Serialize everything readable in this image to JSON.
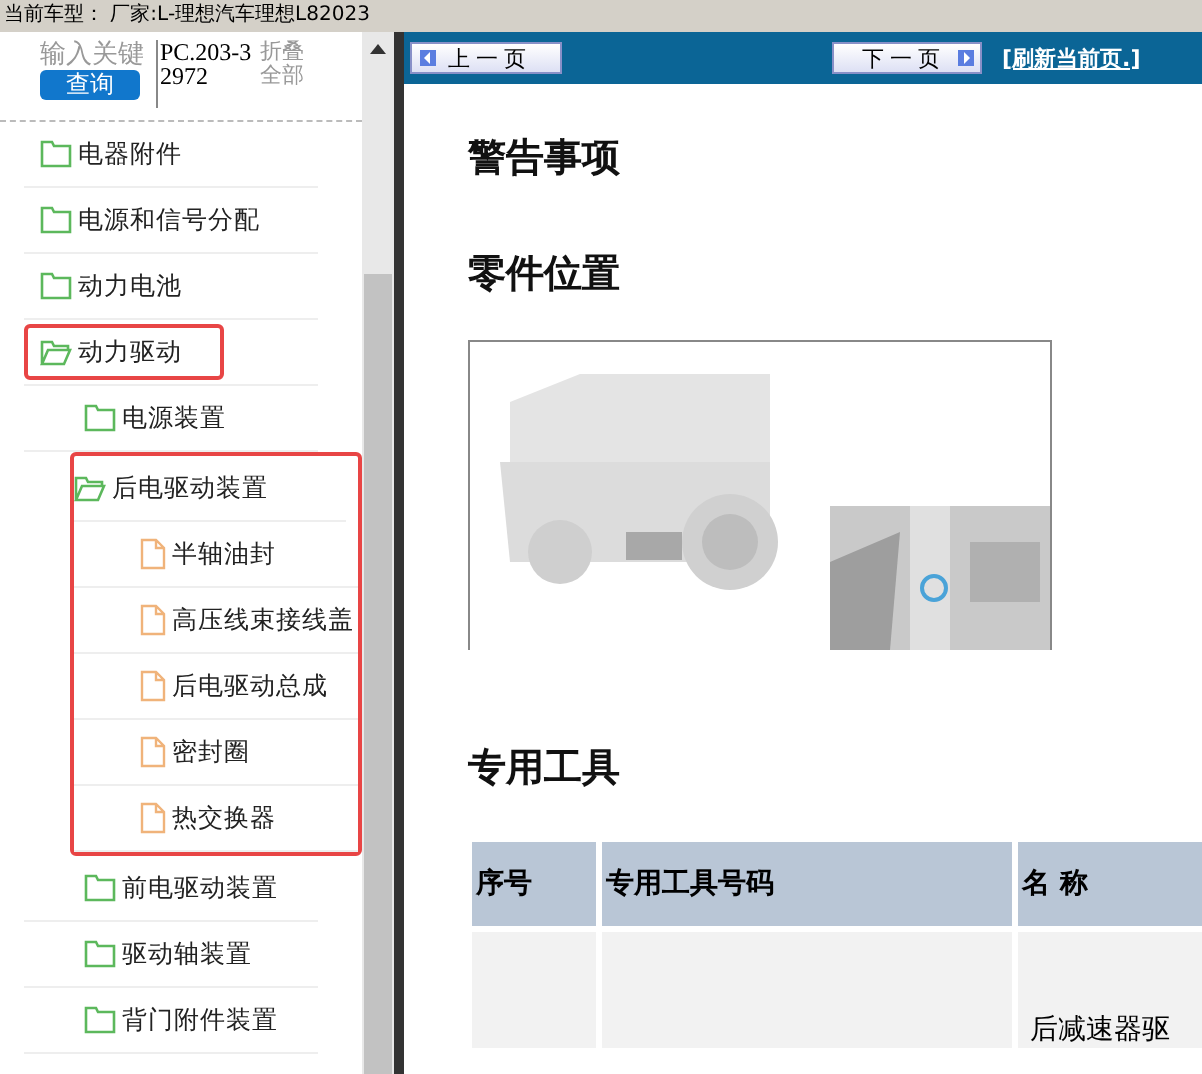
{
  "top_bar": {
    "text": "当前车型：  厂家:L-理想汽车理想L82023"
  },
  "sidebar": {
    "search": {
      "placeholder": "输入关键",
      "button": "查询"
    },
    "code": "PC.203-32972",
    "collapse_all": "折叠全部",
    "tree": [
      {
        "label": "电器附件",
        "kind": "folder",
        "expanded": false,
        "highlighted": false,
        "group_highlighted": false
      },
      {
        "label": "电源和信号分配",
        "kind": "folder",
        "expanded": false,
        "highlighted": false,
        "group_highlighted": false
      },
      {
        "label": "动力电池",
        "kind": "folder",
        "expanded": false,
        "highlighted": false,
        "group_highlighted": false
      },
      {
        "label": "动力驱动",
        "kind": "folder",
        "expanded": true,
        "highlighted": true,
        "group_highlighted": false,
        "children": [
          {
            "label": "电源装置",
            "kind": "folder",
            "expanded": false,
            "highlighted": false,
            "group_highlighted": false
          },
          {
            "label": "后电驱动装置",
            "kind": "folder",
            "expanded": true,
            "highlighted": false,
            "group_highlighted": true,
            "children": [
              {
                "label": "半轴油封",
                "kind": "page"
              },
              {
                "label": "高压线束接线盖",
                "kind": "page"
              },
              {
                "label": "后电驱动总成",
                "kind": "page"
              },
              {
                "label": "密封圈",
                "kind": "page"
              },
              {
                "label": "热交换器",
                "kind": "page"
              }
            ]
          },
          {
            "label": "前电驱动装置",
            "kind": "folder",
            "expanded": false,
            "highlighted": false,
            "group_highlighted": false
          },
          {
            "label": "驱动轴装置",
            "kind": "folder",
            "expanded": false,
            "highlighted": false,
            "group_highlighted": false
          },
          {
            "label": "背门附件装置",
            "kind": "folder",
            "expanded": false,
            "highlighted": false,
            "group_highlighted": false
          }
        ]
      }
    ]
  },
  "toolbar": {
    "prev": "上一页",
    "next": "下一页",
    "refresh": "[刷新当前页.]"
  },
  "content": {
    "sections": [
      {
        "title": "警告事项"
      },
      {
        "title": "零件位置"
      },
      {
        "title": "专用工具"
      }
    ],
    "table": {
      "columns": [
        "序号",
        "专用工具号码",
        "名 称"
      ],
      "rows": [
        [
          "",
          "",
          "后减速器驱"
        ]
      ]
    }
  }
}
